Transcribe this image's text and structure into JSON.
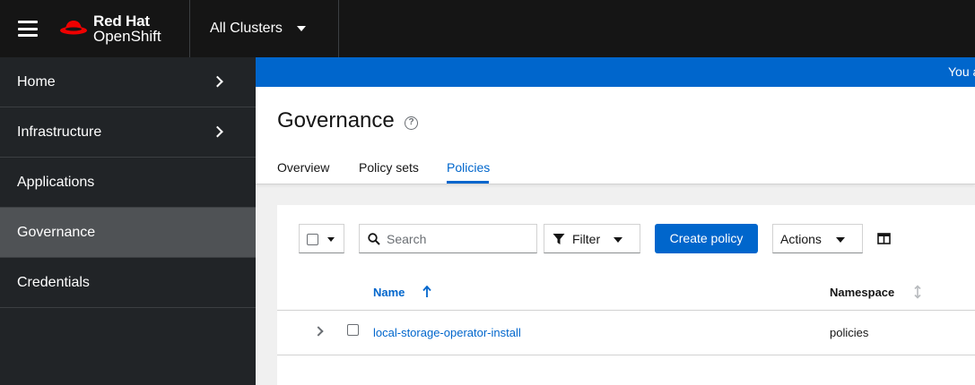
{
  "masthead": {
    "brand_line1": "Red Hat",
    "brand_line2": "OpenShift",
    "cluster_switcher": "All Clusters"
  },
  "sidebar": {
    "items": [
      {
        "label": "Home",
        "expandable": true,
        "active": false
      },
      {
        "label": "Infrastructure",
        "expandable": true,
        "active": false
      },
      {
        "label": "Applications",
        "expandable": false,
        "active": false
      },
      {
        "label": "Governance",
        "expandable": false,
        "active": true
      },
      {
        "label": "Credentials",
        "expandable": false,
        "active": false
      }
    ]
  },
  "banner": {
    "text": "You a"
  },
  "page": {
    "title": "Governance",
    "tabs": [
      {
        "label": "Overview",
        "active": false
      },
      {
        "label": "Policy sets",
        "active": false
      },
      {
        "label": "Policies",
        "active": true
      }
    ]
  },
  "toolbar": {
    "search_placeholder": "Search",
    "filter_label": "Filter",
    "create_label": "Create policy",
    "actions_label": "Actions"
  },
  "table": {
    "columns": [
      {
        "label": "Name",
        "sort": "ascending"
      },
      {
        "label": "Namespace",
        "sort": "none"
      }
    ],
    "rows": [
      {
        "name": "local-storage-operator-install",
        "namespace": "policies"
      }
    ]
  },
  "colors": {
    "masthead": "#151515",
    "sidebar": "#212427",
    "sidebar_active": "#4f5255",
    "accent": "#0066cc",
    "brand_red": "#ee0000"
  },
  "icons": {
    "menu": "hamburger-icon",
    "brand": "redhat-logo",
    "help": "question-circle-icon",
    "search": "search-icon",
    "filter": "filter-icon",
    "columns": "columns-icon",
    "sort_asc": "sort-ascending-icon",
    "sort_none": "sort-icon"
  }
}
